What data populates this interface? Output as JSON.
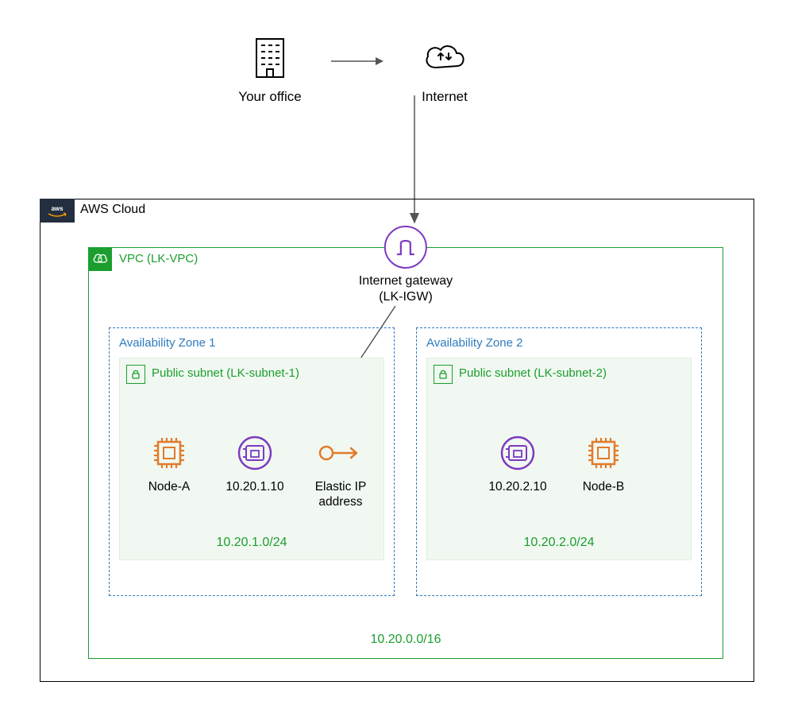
{
  "top": {
    "office_label": "Your office",
    "internet_label": "Internet"
  },
  "aws_cloud_label": "AWS Cloud",
  "vpc_label": "VPC (LK-VPC)",
  "igw": {
    "title": "Internet gateway",
    "name": "(LK-IGW)"
  },
  "az1": {
    "label": "Availability Zone 1",
    "subnet_label": "Public subnet (LK-subnet-1)",
    "node_label": "Node-A",
    "eni_ip": "10.20.1.10",
    "eip_label": "Elastic IP",
    "eip_label2": "address",
    "cidr": "10.20.1.0/24"
  },
  "az2": {
    "label": "Availability Zone 2",
    "subnet_label": "Public subnet (LK-subnet-2)",
    "node_label": "Node-B",
    "eni_ip": "10.20.2.10",
    "cidr": "10.20.2.0/24"
  },
  "vpc_cidr": "10.20.0.0/16",
  "colors": {
    "green": "#1B9E2E",
    "blue": "#2E7BBF",
    "purple": "#7D3AC1",
    "orange": "#E17B2B",
    "aws_navy": "#232F3E"
  }
}
